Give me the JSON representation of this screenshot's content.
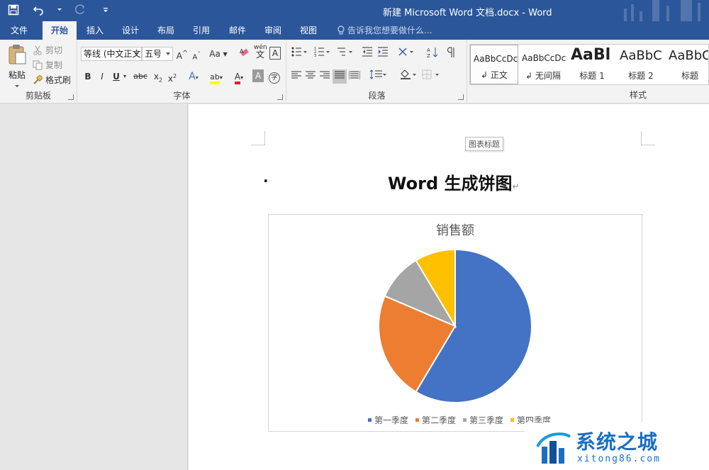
{
  "window": {
    "title": "新建 Microsoft Word 文档.docx - Word"
  },
  "tabs": [
    {
      "label": "文件"
    },
    {
      "label": "开始"
    },
    {
      "label": "插入"
    },
    {
      "label": "设计"
    },
    {
      "label": "布局"
    },
    {
      "label": "引用"
    },
    {
      "label": "邮件"
    },
    {
      "label": "审阅"
    },
    {
      "label": "视图"
    }
  ],
  "active_tab": "开始",
  "tellme": {
    "placeholder": "告诉我您想要做什么..."
  },
  "clipboard": {
    "paste": "粘贴",
    "cut": "剪切",
    "copy": "复制",
    "format_painter": "格式刷",
    "group_label": "剪贴板"
  },
  "font": {
    "family": "等线 (中文正文",
    "size": "五号",
    "grow": "A",
    "shrink": "A",
    "case": "Aa",
    "phonetic": "wén",
    "phonetic_char": "文",
    "border_char": "A",
    "bold": "B",
    "italic": "I",
    "underline": "U",
    "strike": "abc",
    "subscript": "x",
    "superscript": "x",
    "sub_mark": "2",
    "sup_mark": "2",
    "effect": "A",
    "highlight": "ab",
    "color": "A",
    "shade": "A",
    "enclose": "字",
    "group_label": "字体"
  },
  "paragraph": {
    "group_label": "段落"
  },
  "styles": {
    "group_label": "样式",
    "items": [
      {
        "sample": "AaBbCcDc",
        "name": "正文"
      },
      {
        "sample": "AaBbCcDc",
        "name": "无间隔"
      },
      {
        "sample": "AaBl",
        "name": "标题 1"
      },
      {
        "sample": "AaBbC",
        "name": "标题 2"
      },
      {
        "sample": "AaBbC",
        "name": "标题"
      }
    ]
  },
  "document": {
    "caption_tip": "图表标题",
    "bullet": "·",
    "title": "Word 生成饼图",
    "para_mark": "↵"
  },
  "chart_data": {
    "type": "pie",
    "title": "销售额",
    "categories": [
      "第一季度",
      "第二季度",
      "第三季度",
      "第四季度"
    ],
    "values": [
      8.2,
      3.2,
      1.4,
      1.2
    ],
    "colors": [
      "#4472c4",
      "#ed7d31",
      "#a5a5a5",
      "#ffc000"
    ],
    "legend_position": "bottom"
  },
  "watermark": {
    "brand": "系统之城",
    "url": "xitong86.com"
  }
}
